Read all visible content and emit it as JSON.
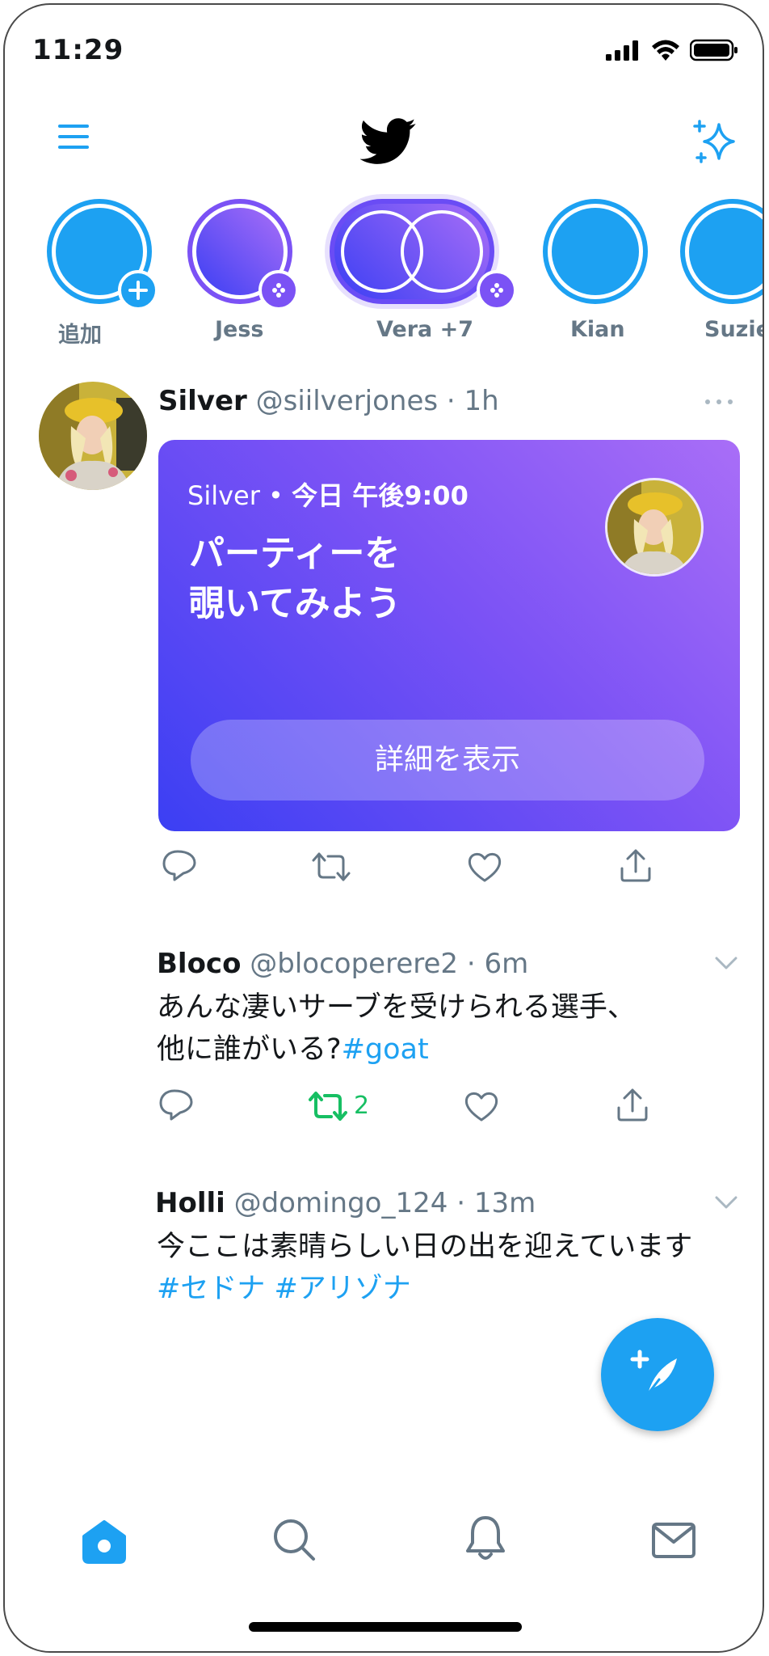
{
  "status_bar": {
    "time": "11:29"
  },
  "colors": {
    "accent": "#1da1f2",
    "retweet_green": "#17bf63",
    "secondary_text": "#657786",
    "card_gradient_start": "#a96ef7",
    "card_gradient_end": "#3b3ff3"
  },
  "header": {
    "menu_icon": "hamburger-icon",
    "logo_icon": "twitter-bird-icon",
    "sparkle_icon": "sparkle-icon"
  },
  "stories": [
    {
      "label": "追加",
      "badge": "plus"
    },
    {
      "label": "Jess",
      "badge": "dots"
    },
    {
      "label": "Vera +7",
      "badge": "dots"
    },
    {
      "label": "Kian",
      "badge": ""
    },
    {
      "label": "Suzie",
      "badge": ""
    }
  ],
  "tweet1": {
    "name": "Silver",
    "handle": "@siilverjones",
    "time": "1h",
    "card": {
      "meta_host": "Silver",
      "meta_time": "今日 午後9:00",
      "title_line1": "パーティーを",
      "title_line2": "覗いてみよう",
      "button": "詳細を表示"
    }
  },
  "tweet2": {
    "name": "Bloco",
    "handle": "@blocoperere2",
    "time": "6m",
    "line1": "あんな凄いサーブを受けられる選手、",
    "line2_text": "他に誰がいる?",
    "line2_hashtag": "#goat",
    "retweet_count": "2"
  },
  "tweet3": {
    "name": "Holli",
    "handle": "@domingo_124",
    "time": "13m",
    "line1": "今ここは素晴らしい日の出を迎えています",
    "hashtag1": "#セドナ",
    "hashtag2": "#アリゾナ"
  },
  "fab": {
    "icon": "compose-tweet-icon"
  },
  "bottom_nav": [
    {
      "icon": "home-icon",
      "active": true
    },
    {
      "icon": "search-icon",
      "active": false
    },
    {
      "icon": "notifications-icon",
      "active": false
    },
    {
      "icon": "messages-icon",
      "active": false
    }
  ]
}
